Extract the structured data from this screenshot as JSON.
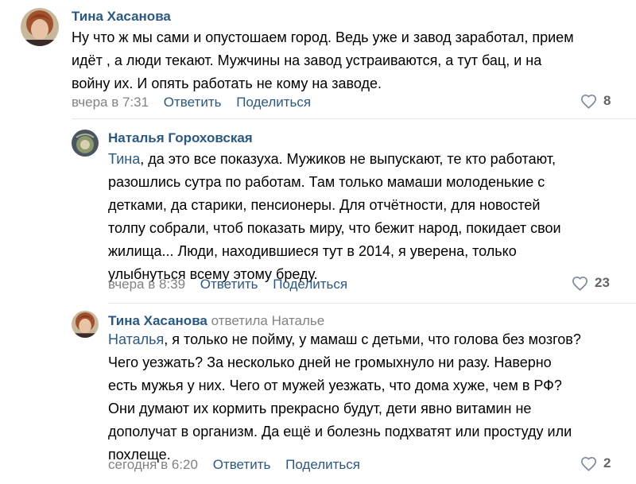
{
  "colors": {
    "link": "#2a5885",
    "meta": "#828282",
    "divider": "#e7e8ec"
  },
  "comments": [
    {
      "author": "Тина Хасанова",
      "reply_to": "",
      "mention": "",
      "lines": [
        "Ну что ж мы сами и опустошаем город. Ведь уже и завод заработал, прием",
        "идёт , а люди текают. Мужчины на завод устраиваются, а тут бац, и на",
        "войну их. И опять работать не кому на заводе."
      ],
      "time": "вчера в 7:31",
      "reply_label": "Ответить",
      "share_label": "Поделиться",
      "likes": "8",
      "like_icon": "heart-icon"
    },
    {
      "author": "Наталья Гороховская",
      "reply_to": "",
      "mention": "Тина",
      "first_line_rest": ", да это все показуха. Мужиков не выпускают, те кто работают,",
      "lines": [
        "разошлись сутра по работам. Там только мамаши молоденькие с",
        "детками, да старики, пенсионеры. Для отчётности, для новостей",
        "толпу собрали, чтоб показать миру, что бежит народ, покидает свои",
        "жилища... Люди, находившиеся тут в 2014, я уверена, только",
        "улыбнуться всему этому бреду."
      ],
      "time": "вчера в 8:39",
      "reply_label": "Ответить",
      "share_label": "Поделиться",
      "likes": "23",
      "like_icon": "heart-icon"
    },
    {
      "author": "Тина Хасанова",
      "reply_to": "ответила Наталье",
      "mention": "Наталья",
      "first_line_rest": ", я только не пойму, у мамаш с детьми, что голова без мозгов?",
      "lines": [
        "Чего уезжать? За несколько дней не громыхнуло ни разу. Наверно",
        "есть мужья у них. Чего от мужей уезжать, что дома хуже, чем в РФ?",
        "Они думают их кормить прекрасно будут, дети явно витамин не",
        "дополучат в организм. Да ещё и болезнь подхватят или простуду или",
        "похлеще."
      ],
      "time": "сегодня в 6:20",
      "reply_label": "Ответить",
      "share_label": "Поделиться",
      "likes": "2",
      "like_icon": "heart-icon"
    }
  ]
}
